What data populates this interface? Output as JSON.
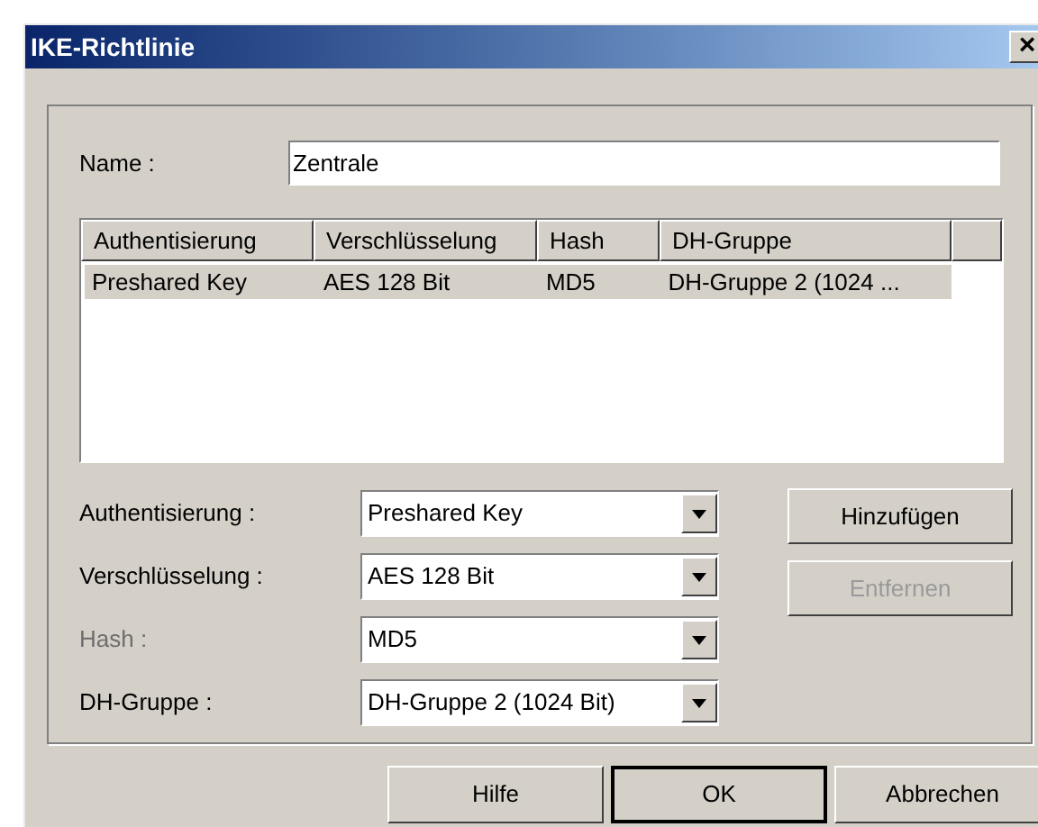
{
  "window": {
    "title": "IKE-Richtlinie",
    "close": "×"
  },
  "name_field": {
    "label": "Name :",
    "value": "Zentrale"
  },
  "table": {
    "columns": [
      "Authentisierung",
      "Verschlüsselung",
      "Hash",
      "DH-Gruppe"
    ],
    "rows": [
      {
        "cells": [
          "Preshared Key",
          "AES 128 Bit",
          "MD5",
          "DH-Gruppe 2 (1024 ..."
        ],
        "selected": true
      }
    ]
  },
  "fields": [
    {
      "label": "Authentisierung :",
      "value": "Preshared Key",
      "disabled": false
    },
    {
      "label": "Verschlüsselung :",
      "value": "AES 128 Bit",
      "disabled": false
    },
    {
      "label": "Hash :",
      "value": "MD5",
      "disabled": true
    },
    {
      "label": "DH-Gruppe :",
      "value": "DH-Gruppe 2 (1024 Bit)",
      "disabled": false
    }
  ],
  "side_buttons": [
    {
      "label": "Hinzufügen",
      "disabled": false
    },
    {
      "label": "Entfernen",
      "disabled": true
    }
  ],
  "buttons": [
    {
      "label": "Hilfe",
      "default": false
    },
    {
      "label": "OK",
      "default": true
    },
    {
      "label": "Abbrechen",
      "default": false
    }
  ]
}
